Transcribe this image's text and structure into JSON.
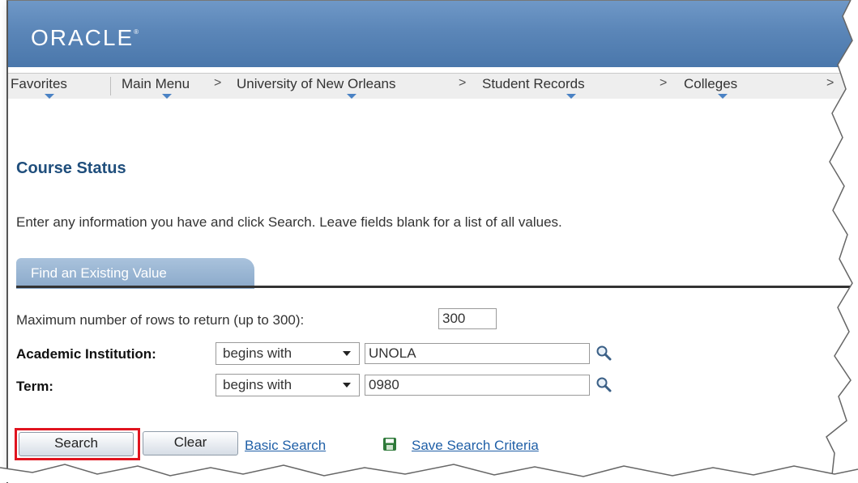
{
  "header": {
    "logo_text": "ORACLE",
    "logo_mark": "®"
  },
  "breadcrumb": {
    "items": [
      {
        "label": "Favorites"
      },
      {
        "label": "Main Menu"
      },
      {
        "label": "University of New Orleans"
      },
      {
        "label": "Student Records"
      },
      {
        "label": "Colleges"
      }
    ],
    "separator": ">"
  },
  "page": {
    "title": "Course Status",
    "instructions": "Enter any information you have and click Search. Leave fields blank for a list of all values."
  },
  "tabs": {
    "active": "Find an Existing Value"
  },
  "form": {
    "max_rows_label": "Maximum number of rows to return (up to 300):",
    "max_rows_value": "300",
    "institution_label": "Academic Institution:",
    "institution_operator": "begins with",
    "institution_value": "UNOLA",
    "term_label": "Term:",
    "term_operator": "begins with",
    "term_value": "0980"
  },
  "actions": {
    "search_label": "Search",
    "clear_label": "Clear",
    "basic_search_label": "Basic Search",
    "save_criteria_label": "Save Search Criteria"
  },
  "colors": {
    "header_blue": "#5b86b8",
    "title_blue": "#1f4e7c",
    "link_blue": "#1f5fa7",
    "highlight_red": "#e0141f"
  }
}
